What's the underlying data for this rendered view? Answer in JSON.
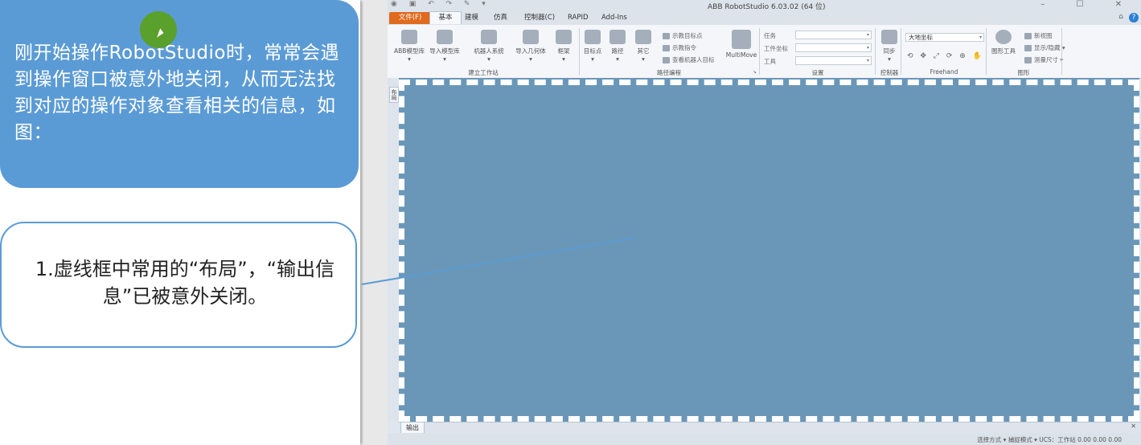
{
  "slide": {
    "intro_text": "刚开始操作RobotStudio时，常常会遇到操作窗口被意外地关闭，从而无法找到对应的操作对象查看相关的信息，如图：",
    "callout_text": "1.虚线框中常用的“布局”，“输出信息”已被意外关闭。"
  },
  "app": {
    "title": "ABB RobotStudio 6.03.02 (64 位)",
    "tabs": [
      "文件(F)",
      "基本",
      "建模",
      "仿真",
      "控制器(C)",
      "RAPID",
      "Add-Ins"
    ],
    "ribbon": {
      "groups": {
        "build_station": {
          "label": "建立工作站",
          "buttons": [
            "ABB模型库",
            "导入模型库",
            "机器人系统",
            "导入几何体",
            "框架"
          ]
        },
        "path_programming": {
          "label": "路径编程",
          "buttons": [
            "目标点",
            "路径",
            "其它"
          ],
          "small_items": [
            "示教目标点",
            "示教指令",
            "查看机器人目标"
          ],
          "multimove": "MultiMove"
        },
        "settings": {
          "label": "设置",
          "fields": [
            {
              "label": "任务",
              "value": ""
            },
            {
              "label": "工件坐标",
              "value": ""
            },
            {
              "label": "工具",
              "value": ""
            }
          ]
        },
        "controller": {
          "label": "控制器",
          "button": "同步"
        },
        "freehand": {
          "label": "Freehand",
          "coord_value": "大地坐标"
        },
        "graphics": {
          "label": "图形",
          "button": "图形工具",
          "small_items": [
            "新视图",
            "显示/隐藏",
            "测量尺寸"
          ]
        }
      }
    },
    "left_tab": "布局",
    "output_tab": "输出",
    "status": "选择方式 ▾  捕捉模式 ▾  UCS：工作站  0.00  0.00  0.00"
  },
  "colors": {
    "slide_blue": "#5b9bd5",
    "workspace": "#6a97b8",
    "file_tab": "#e06a1d"
  }
}
